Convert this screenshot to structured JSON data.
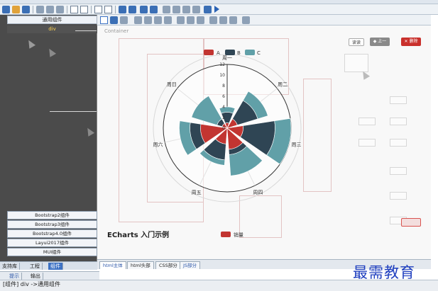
{
  "header": {
    "hint": "…"
  },
  "left_panel": {
    "title": "通用组件",
    "selected_item": "div",
    "groups": [
      {
        "label": "Bootstrap2组件"
      },
      {
        "label": "Bootstrap3组件"
      },
      {
        "label": "Bootstrap4.0组件"
      },
      {
        "label": "Layui2017组件"
      },
      {
        "label": "MUI组件"
      }
    ],
    "tabs": [
      {
        "label": "支持库"
      },
      {
        "label": "工程"
      },
      {
        "label": "组件"
      }
    ],
    "active_tab": "组件"
  },
  "bottom_tabs": [
    {
      "label": "提示"
    },
    {
      "label": "输出"
    }
  ],
  "status_text": "[组件] div ->通用组件",
  "designer": {
    "container_label": "Container",
    "title_text": "ECharts 入门示例",
    "legend_salary": "销量",
    "btn_left": "读读",
    "btn_mid": "◆ 上一",
    "btn_right": "✕ 删除"
  },
  "page_tabs": [
    {
      "label": "html主体"
    },
    {
      "label": "html头部"
    },
    {
      "label": "CSS部分"
    },
    {
      "label": "JS部分"
    }
  ],
  "active_page_tab": "html主体",
  "watermark": "最需教育",
  "colors": {
    "series_a": "#c23531",
    "series_b": "#2f4554",
    "series_c": "#61a0a8",
    "accent_blue": "#3d72c4"
  },
  "chart_data": {
    "type": "polar-stacked-bar",
    "categories": [
      "周一",
      "周二",
      "周三",
      "周四",
      "周五",
      "周六",
      "周日"
    ],
    "radius_ticks": [
      "0",
      "2",
      "4",
      "6",
      "8",
      "10",
      "12"
    ],
    "radius_max": 12,
    "series": [
      {
        "name": "A",
        "values": [
          1,
          2,
          3,
          4,
          3,
          5,
          1
        ]
      },
      {
        "name": "B",
        "values": [
          2,
          4,
          6,
          1,
          3,
          2,
          1
        ]
      },
      {
        "name": "C",
        "values": [
          1,
          2,
          3,
          4,
          1,
          2,
          5
        ]
      }
    ],
    "legend_position": "top"
  }
}
